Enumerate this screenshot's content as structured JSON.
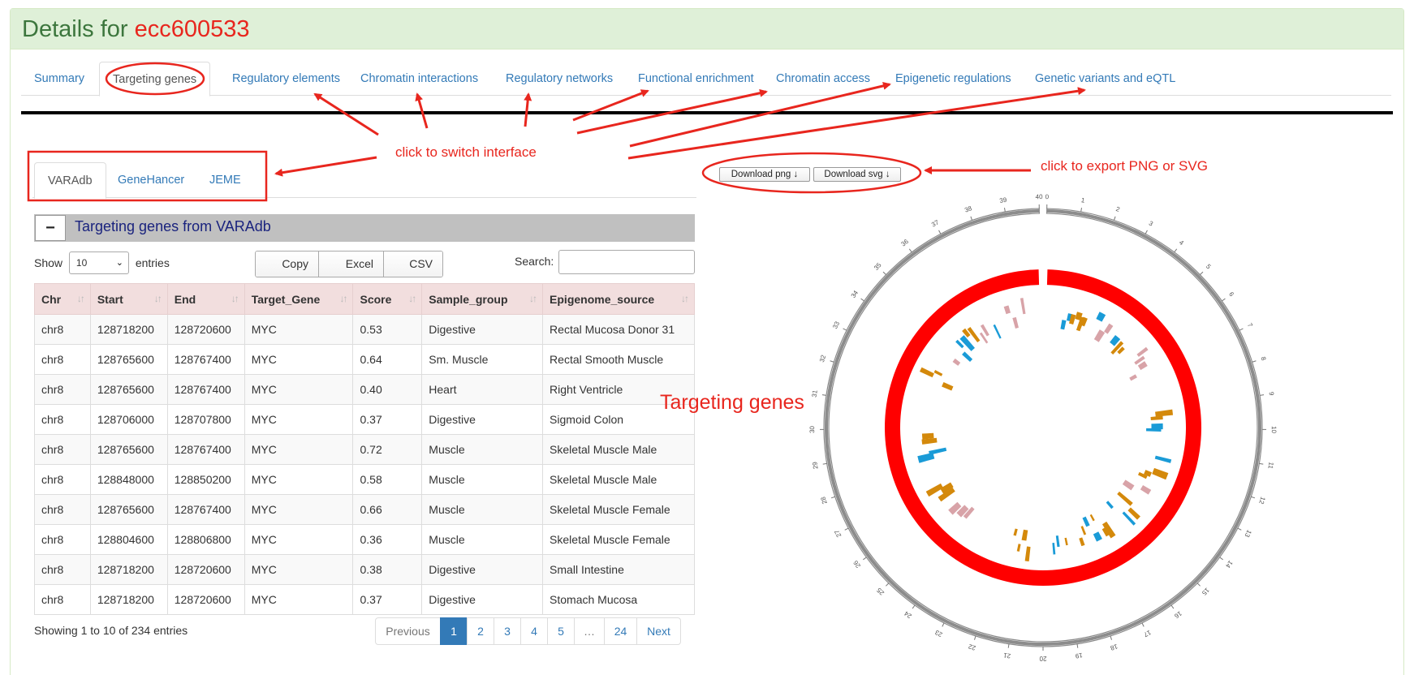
{
  "header": {
    "prefix": "Details for",
    "accession": "ecc600533"
  },
  "main_tabs": [
    {
      "label": "Summary",
      "active": false
    },
    {
      "label": "Targeting genes",
      "active": true
    },
    {
      "label": "Regulatory elements",
      "active": false
    },
    {
      "label": "Chromatin interactions",
      "active": false
    },
    {
      "label": "Regulatory networks",
      "active": false
    },
    {
      "label": "Functional enrichment",
      "active": false
    },
    {
      "label": "Chromatin access",
      "active": false
    },
    {
      "label": "Epigenetic regulations",
      "active": false
    },
    {
      "label": "Genetic variants and eQTL",
      "active": false
    }
  ],
  "sub_tabs": [
    {
      "label": "VARAdb",
      "active": true
    },
    {
      "label": "GeneHancer",
      "active": false
    },
    {
      "label": "JEME",
      "active": false
    }
  ],
  "section": {
    "collapse_symbol": "−",
    "title": "Targeting genes from VARAdb"
  },
  "controls": {
    "show_label": "Show",
    "page_length": "10",
    "entries_label": "entries",
    "copy_label": "Copy",
    "excel_label": "Excel",
    "csv_label": "CSV",
    "search_label": "Search:",
    "search_value": ""
  },
  "table": {
    "columns": [
      "Chr",
      "Start",
      "End",
      "Target_Gene",
      "Score",
      "Sample_group",
      "Epigenome_source"
    ],
    "rows": [
      [
        "chr8",
        "128718200",
        "128720600",
        "MYC",
        "0.53",
        "Digestive",
        "Rectal Mucosa Donor 31"
      ],
      [
        "chr8",
        "128765600",
        "128767400",
        "MYC",
        "0.64",
        "Sm. Muscle",
        "Rectal Smooth Muscle"
      ],
      [
        "chr8",
        "128765600",
        "128767400",
        "MYC",
        "0.40",
        "Heart",
        "Right Ventricle"
      ],
      [
        "chr8",
        "128706000",
        "128707800",
        "MYC",
        "0.37",
        "Digestive",
        "Sigmoid Colon"
      ],
      [
        "chr8",
        "128765600",
        "128767400",
        "MYC",
        "0.72",
        "Muscle",
        "Skeletal Muscle Male"
      ],
      [
        "chr8",
        "128848000",
        "128850200",
        "MYC",
        "0.58",
        "Muscle",
        "Skeletal Muscle Male"
      ],
      [
        "chr8",
        "128765600",
        "128767400",
        "MYC",
        "0.66",
        "Muscle",
        "Skeletal Muscle Female"
      ],
      [
        "chr8",
        "128804600",
        "128806800",
        "MYC",
        "0.36",
        "Muscle",
        "Skeletal Muscle Female"
      ],
      [
        "chr8",
        "128718200",
        "128720600",
        "MYC",
        "0.38",
        "Digestive",
        "Small Intestine"
      ],
      [
        "chr8",
        "128718200",
        "128720600",
        "MYC",
        "0.37",
        "Digestive",
        "Stomach Mucosa"
      ]
    ]
  },
  "info": "Showing 1 to 10 of 234 entries",
  "pagination": [
    {
      "label": "Previous",
      "state": "disabled"
    },
    {
      "label": "1",
      "state": "active"
    },
    {
      "label": "2",
      "state": "normal"
    },
    {
      "label": "3",
      "state": "normal"
    },
    {
      "label": "4",
      "state": "normal"
    },
    {
      "label": "5",
      "state": "normal"
    },
    {
      "label": "…",
      "state": "disabled"
    },
    {
      "label": "24",
      "state": "normal"
    },
    {
      "label": "Next",
      "state": "normal"
    }
  ],
  "downloads": {
    "png_label": "Download png ↓",
    "svg_label": "Download svg ↓"
  },
  "circos": {
    "tick_labels": [
      "0",
      "1",
      "2",
      "3",
      "4",
      "5",
      "6",
      "7",
      "8",
      "9",
      "10",
      "11",
      "12",
      "13",
      "14",
      "15",
      "16",
      "17",
      "18",
      "19",
      "20",
      "21",
      "22",
      "23",
      "24",
      "25",
      "26",
      "27",
      "28",
      "29",
      "30",
      "31",
      "32",
      "33",
      "34",
      "35",
      "36",
      "37",
      "38",
      "39",
      "40"
    ],
    "colors": {
      "main_ring": "#ff0000",
      "ideogram": "#8c8c8c",
      "blue": "#1a9bd7",
      "orange": "#d4890b",
      "pink": "#d8a3a8"
    }
  },
  "annotations": {
    "switch_interface": "click to switch interface",
    "export": "click to export PNG or SVG",
    "targeting_genes": "Targeting genes",
    "color": "#e8261e"
  }
}
